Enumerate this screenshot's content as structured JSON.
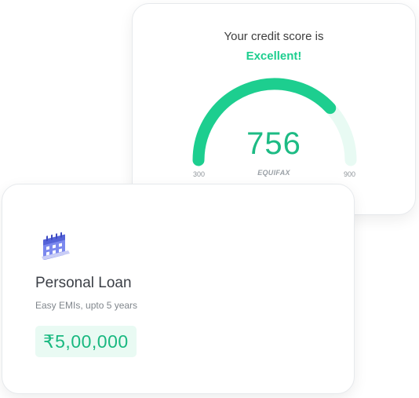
{
  "credit_score": {
    "heading": "Your credit score is",
    "rating": "Excellent!",
    "score": "756",
    "score_value": 756,
    "scale_min": "300",
    "scale_max": "900",
    "min_value": 300,
    "max_value": 900,
    "bureau": "EQUIFAX"
  },
  "loan": {
    "title": "Personal Loan",
    "subtitle": "Easy EMIs, upto 5 years",
    "amount": "₹5,00,000",
    "icon": "calendar-icon"
  },
  "colors": {
    "accent": "#1dce8f",
    "gauge_track": "#e8faf3",
    "amount_bg": "#e9faf3",
    "calendar_icon": "#6b78e5"
  }
}
